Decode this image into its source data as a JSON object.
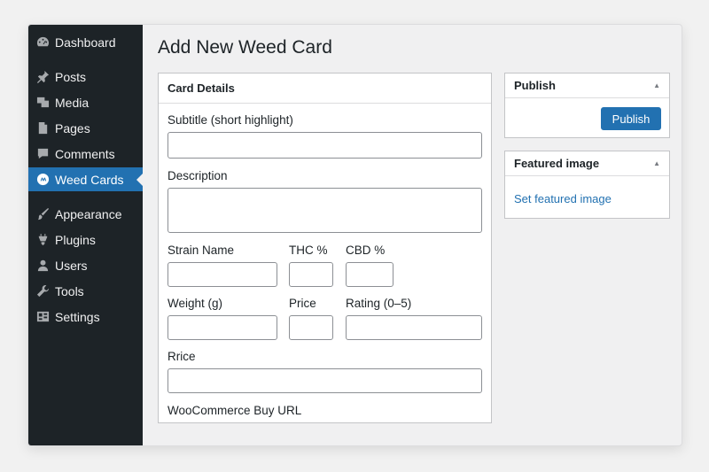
{
  "sidebar": {
    "items": [
      {
        "label": "Dashboard",
        "icon": "dashboard-icon"
      },
      {
        "label": "Posts",
        "icon": "pin-icon"
      },
      {
        "label": "Media",
        "icon": "media-icon"
      },
      {
        "label": "Pages",
        "icon": "pages-icon"
      },
      {
        "label": "Comments",
        "icon": "comments-icon"
      },
      {
        "label": "Weed Cards",
        "icon": "weed-cards-icon",
        "active": true
      },
      {
        "label": "Appearance",
        "icon": "brush-icon"
      },
      {
        "label": "Plugins",
        "icon": "plugin-icon"
      },
      {
        "label": "Users",
        "icon": "users-icon"
      },
      {
        "label": "Tools",
        "icon": "wrench-icon"
      },
      {
        "label": "Settings",
        "icon": "settings-icon"
      }
    ]
  },
  "page": {
    "title": "Add New Weed Card"
  },
  "card_details": {
    "title": "Card Details",
    "fields": {
      "subtitle": {
        "label": "Subtitle (short highlight)",
        "value": ""
      },
      "description": {
        "label": "Description",
        "value": ""
      },
      "strain_name": {
        "label": "Strain Name",
        "value": ""
      },
      "thc": {
        "label": "THC %",
        "value": ""
      },
      "cbd": {
        "label": "CBD %",
        "value": ""
      },
      "weight": {
        "label": "Weight (g)",
        "value": ""
      },
      "price": {
        "label": "Price",
        "value": ""
      },
      "rating": {
        "label": "Rating (0–5)",
        "value": ""
      },
      "rrice": {
        "label": "Rrice",
        "value": ""
      },
      "buy_url": {
        "label": "WooCommerce Buy URL"
      }
    }
  },
  "publish": {
    "title": "Publish",
    "toggle": "▲",
    "button_label": "Publish"
  },
  "featured_image": {
    "title": "Featured image",
    "toggle": "▲",
    "link_label": "Set featured image"
  },
  "colors": {
    "accent": "#2271b1",
    "sidebar_bg": "#1d2327"
  }
}
